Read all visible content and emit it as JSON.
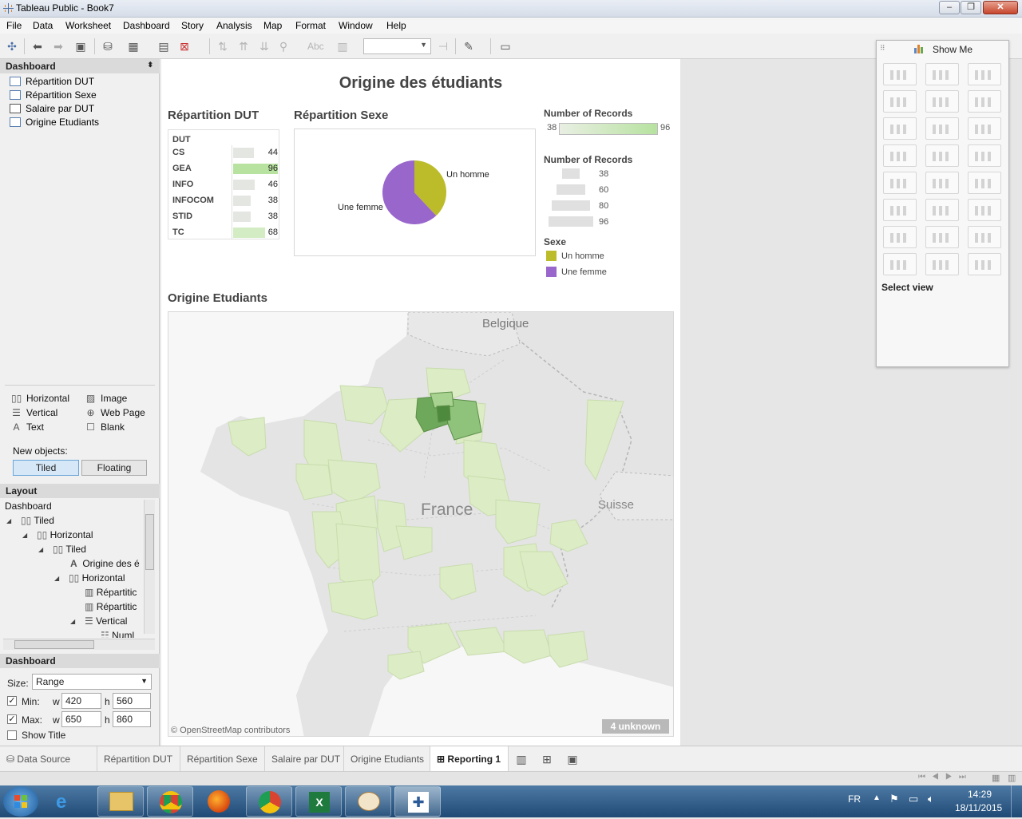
{
  "window": {
    "title": "Tableau Public - Book7"
  },
  "menu": [
    "File",
    "Data",
    "Worksheet",
    "Dashboard",
    "Story",
    "Analysis",
    "Map",
    "Format",
    "Window",
    "Help"
  ],
  "toolbar": {
    "abc_label": "Abc"
  },
  "left": {
    "dashboard_header": "Dashboard",
    "sheets": [
      "Répartition DUT",
      "Répartition Sexe",
      "Salaire par DUT",
      "Origine Etudiants"
    ],
    "objects": {
      "horizontal": "Horizontal",
      "image": "Image",
      "vertical": "Vertical",
      "webpage": "Web Page",
      "text": "Text",
      "blank": "Blank"
    },
    "new_objects_label": "New objects:",
    "tiled": "Tiled",
    "floating": "Floating",
    "layout_header": "Layout",
    "layout_tree": [
      "Dashboard",
      "Tiled",
      "Horizontal",
      "Tiled",
      "Origine des é",
      "Horizontal",
      "Répartitic",
      "Répartitic",
      "Vertical",
      "Numl"
    ],
    "dashboard_header2": "Dashboard",
    "size_label": "Size:",
    "size_value": "Range",
    "min_label": "Min:",
    "max_label": "Max:",
    "w": "w",
    "h": "h",
    "min_w": "420",
    "min_h": "560",
    "max_w": "650",
    "max_h": "860",
    "show_title": "Show Title"
  },
  "dashboard": {
    "title": "Origine des étudiants",
    "dut_title": "Répartition DUT",
    "dut_header": "DUT",
    "dut_rows": [
      {
        "label": "CS",
        "value": "44",
        "fill": 0.46
      },
      {
        "label": "GEA",
        "value": "96",
        "fill": 1.0
      },
      {
        "label": "INFO",
        "value": "46",
        "fill": 0.48
      },
      {
        "label": "INFOCOM",
        "value": "38",
        "fill": 0.4
      },
      {
        "label": "STID",
        "value": "38",
        "fill": 0.4
      },
      {
        "label": "TC",
        "value": "68",
        "fill": 0.71
      }
    ],
    "sexe_title": "Répartition Sexe",
    "pie_labels": {
      "homme": "Un homme",
      "femme": "Une femme"
    },
    "pie_share_homme": 0.38,
    "legend_color_title": "Number of Records",
    "legend_color_min": "38",
    "legend_color_max": "96",
    "legend_size_title": "Number of Records",
    "legend_size_values": [
      "38",
      "60",
      "80",
      "96"
    ],
    "legend_sexe_title": "Sexe",
    "legend_sexe_items": [
      "Un homme",
      "Une femme"
    ],
    "colors": {
      "homme": "#bcbc2a",
      "femme": "#9966cc",
      "map_dark": "#6ea85a",
      "map_light": "#dcecc4"
    },
    "map_title": "Origine Etudiants",
    "map_labels": {
      "belgique": "Belgique",
      "france": "France",
      "suisse": "Suisse"
    },
    "map_credit": "© OpenStreetMap contributors",
    "map_unknown": "4 unknown"
  },
  "showme": {
    "title": "Show Me",
    "footer": "Select view"
  },
  "tabs": [
    "Data Source",
    "Répartition DUT",
    "Répartition Sexe",
    "Salaire par DUT",
    "Origine Etudiants",
    "Reporting 1"
  ],
  "taskbar": {
    "lang": "FR",
    "time": "14:29",
    "date": "18/11/2015"
  }
}
